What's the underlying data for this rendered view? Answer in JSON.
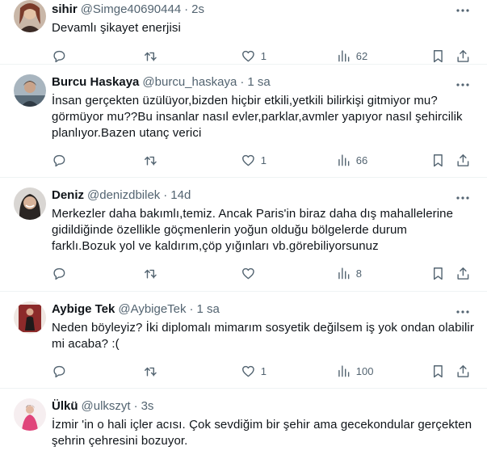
{
  "tweets": [
    {
      "name": "sihir",
      "handle": "@Simge40690444",
      "dot": "·",
      "time": "2s",
      "text": "Devamlı şikayet enerjisi",
      "replies": "",
      "retweets": "",
      "likes": "1",
      "views": "62",
      "avatar_color": "#b98a6f"
    },
    {
      "name": "Burcu Haskaya",
      "handle": "@burcu_haskaya",
      "dot": "·",
      "time": "1 sa",
      "text": "İnsan gerçekten üzülüyor,bizden hiçbir etkili,yetkili bilirkişi gitmiyor mu? görmüyor mu??Bu insanlar nasıl evler,parklar,avmler yapıyor nasıl şehircilik planlıyor.Bazen utanç verici",
      "replies": "",
      "retweets": "",
      "likes": "1",
      "views": "66",
      "avatar_color": "#7d8894"
    },
    {
      "name": "Deniz",
      "handle": "@denizdbilek",
      "dot": "·",
      "time": "14d",
      "text": "Merkezler daha bakımlı,temiz. Ancak Paris'in biraz daha dış mahallelerine gidildiğinde özellikle göçmenlerin yoğun olduğu bölgelerde durum farklı.Bozuk yol ve kaldırım,çöp yığınları vb.görebiliyorsunuz",
      "replies": "",
      "retweets": "",
      "likes": "",
      "views": "8",
      "avatar_color": "#3d3b3a"
    },
    {
      "name": "Aybige Tek",
      "handle": "@AybigeTek",
      "dot": "·",
      "time": "1 sa",
      "text": "Neden böyleyiz? İki diplomalı mimarım sosyetik değilsem iş yok ondan olabilir mi acaba? :(",
      "replies": "",
      "retweets": "",
      "likes": "1",
      "views": "100",
      "avatar_color": "#8c2a2a"
    },
    {
      "name": "Ülkü",
      "handle": "@ulkszyt",
      "dot": "·",
      "time": "3s",
      "text": "İzmir 'in o hali içler acısı. Çok sevdiğim bir şehir ama gecekondular gerçekten şehrin çehresini bozuyor.",
      "replies": "",
      "retweets": "",
      "likes": "",
      "views": "",
      "avatar_color": "#e8b7c4"
    }
  ]
}
